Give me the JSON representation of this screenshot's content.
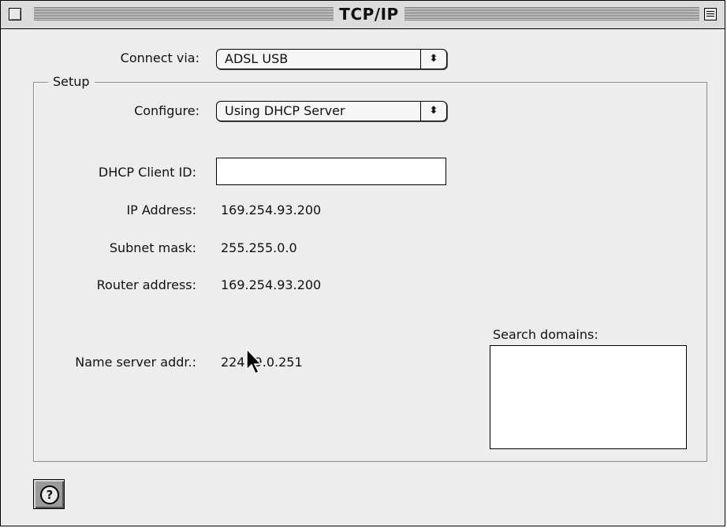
{
  "window": {
    "title": "TCP/IP"
  },
  "connect_via": {
    "label": "Connect via:",
    "selected": "ADSL USB"
  },
  "setup": {
    "group_label": "Setup",
    "configure": {
      "label": "Configure:",
      "selected": "Using DHCP Server"
    },
    "dhcp_client_id": {
      "label": "DHCP Client ID:",
      "value": ""
    },
    "ip_address": {
      "label": "IP Address:",
      "value": "169.254.93.200"
    },
    "subnet_mask": {
      "label": "Subnet mask:",
      "value": "255.255.0.0"
    },
    "router_address": {
      "label": "Router address:",
      "value": "169.254.93.200"
    },
    "name_server": {
      "label": "Name server addr.:",
      "value_start": "224",
      "value_end": "9.0.251"
    },
    "search_domains": {
      "label": "Search domains:",
      "value": ""
    }
  },
  "icons": {
    "close": "close-box-icon",
    "zoom": "zoom-box-icon",
    "help": "question-mark-icon",
    "popup_arrows": "up-down-arrows-icon",
    "cursor": "arrow-cursor-icon"
  },
  "glyphs": {
    "popup_arrows": "⬍",
    "help": "?"
  }
}
